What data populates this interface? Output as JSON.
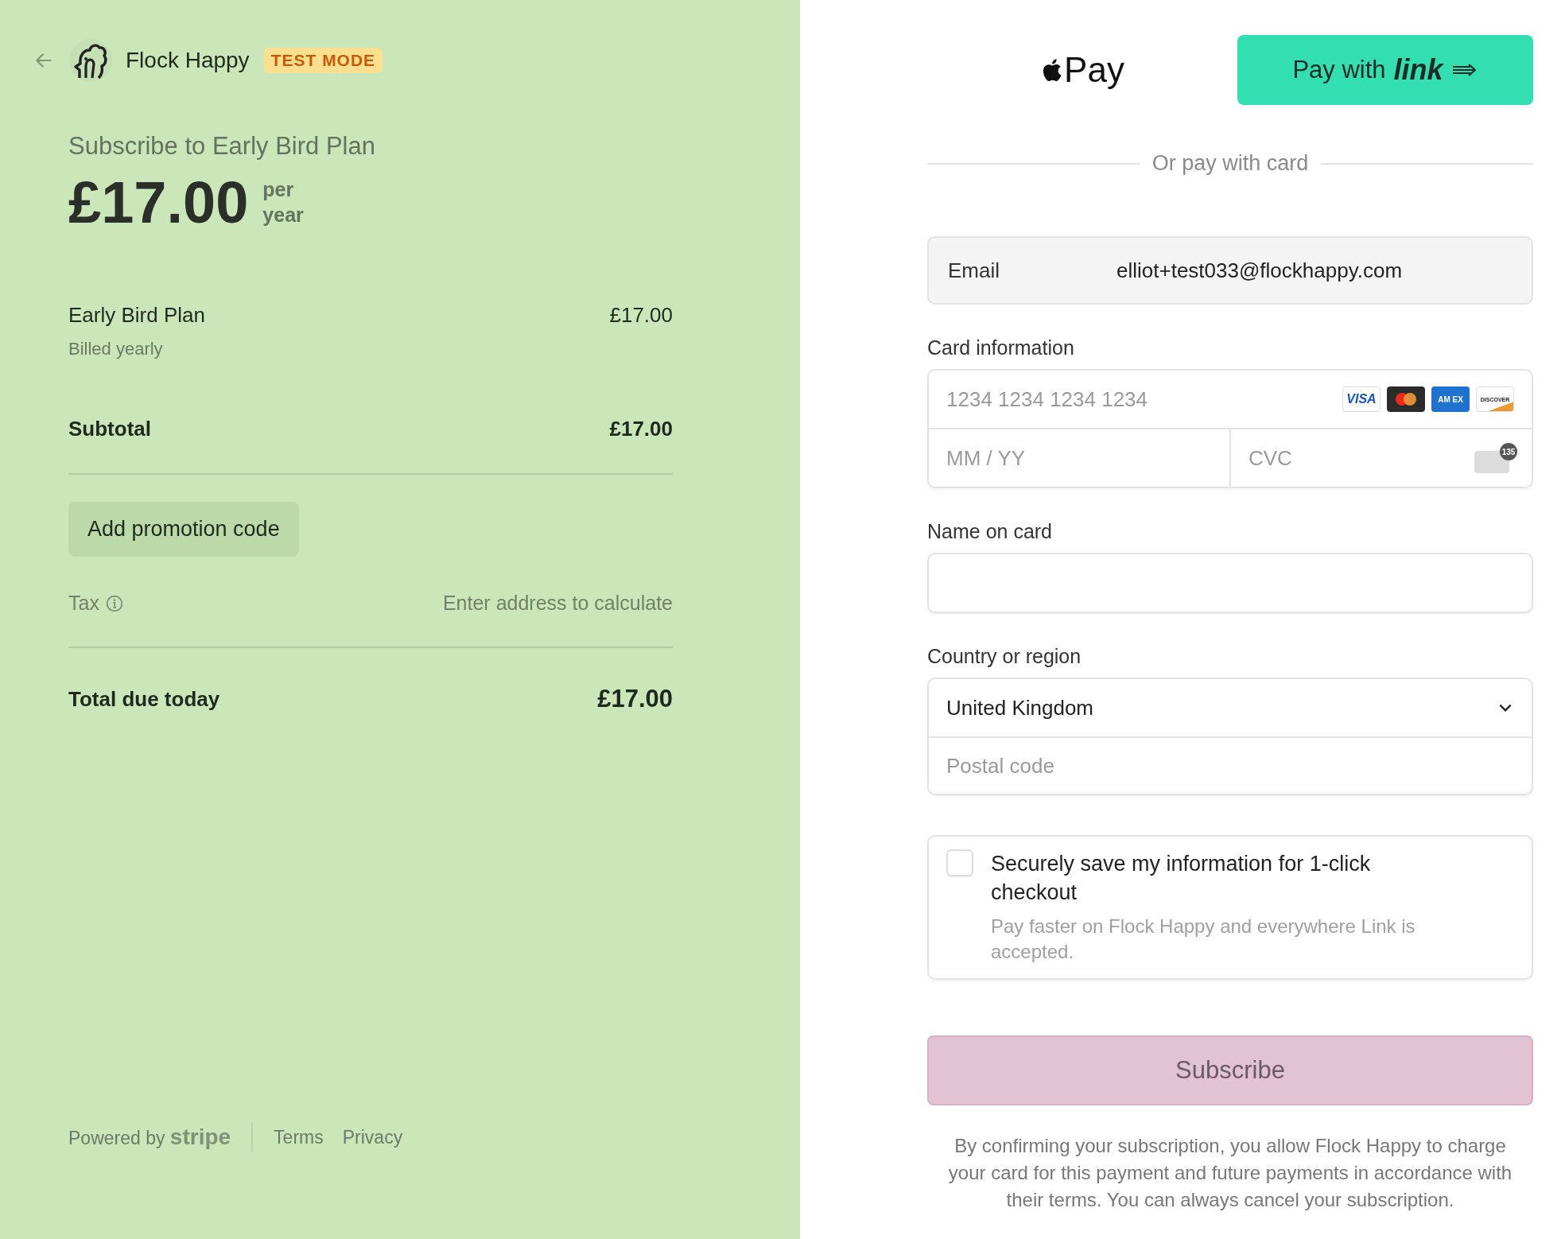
{
  "merchant": {
    "name": "Flock Happy",
    "badge": "TEST MODE"
  },
  "summary": {
    "title": "Subscribe to Early Bird Plan",
    "price": "£17.00",
    "period_1": "per",
    "period_2": "year"
  },
  "line_items": [
    {
      "name": "Early Bird Plan",
      "detail": "Billed yearly",
      "amount": "£17.00"
    }
  ],
  "subtotal": {
    "label": "Subtotal",
    "amount": "£17.00"
  },
  "promo_button": "Add promotion code",
  "tax": {
    "label": "Tax",
    "value": "Enter address to calculate"
  },
  "total": {
    "label": "Total due today",
    "amount": "£17.00"
  },
  "footer": {
    "powered_by": "Powered by",
    "brand": "stripe",
    "links": [
      "Terms",
      "Privacy"
    ]
  },
  "wallets": {
    "apple_pay": "Pay",
    "link_button_prefix": "Pay with",
    "link_button_brand": "link"
  },
  "divider_text": "Or pay with card",
  "email": {
    "label": "Email",
    "value": "elliot+test033@flockhappy.com"
  },
  "card": {
    "label": "Card information",
    "number_placeholder": "1234 1234 1234 1234",
    "expiry_placeholder": "MM / YY",
    "cvc_placeholder": "CVC",
    "brands": [
      {
        "kind": "visa",
        "text": "VISA"
      },
      {
        "kind": "mastercard"
      },
      {
        "kind": "amex",
        "text": "AM EX"
      },
      {
        "kind": "discover",
        "text": "DISCOVER"
      }
    ],
    "cvc_icon_text": "135"
  },
  "name_on_card": {
    "label": "Name on card"
  },
  "country": {
    "label": "Country or region",
    "value": "United Kingdom",
    "postal_placeholder": "Postal code"
  },
  "save_info": {
    "checked": false,
    "title": "Securely save my information for 1-click checkout",
    "description": "Pay faster on Flock Happy and everywhere Link is accepted."
  },
  "subscribe": {
    "label": "Subscribe",
    "disabled": true
  },
  "legal": "By confirming your subscription, you allow Flock Happy to charge your card for this payment and future payments in accordance with their terms. You can always cancel your subscription."
}
